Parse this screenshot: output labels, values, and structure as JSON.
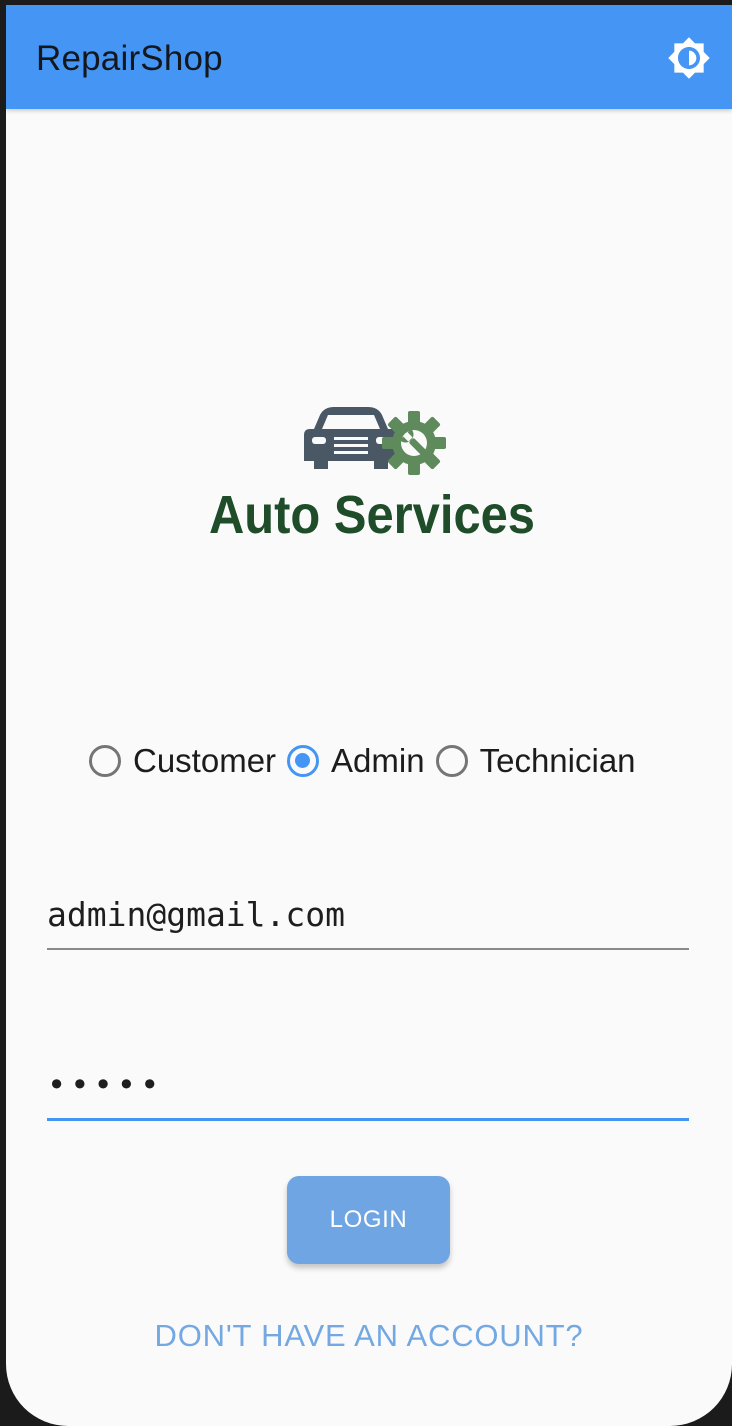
{
  "colors": {
    "primary": "#4596f4",
    "button_disabled": "#6fa5e2",
    "link": "#74a8e3",
    "logo_dark": "#4a5866",
    "logo_green": "#5f8a5c",
    "logo_text": "#1f4d2a"
  },
  "appbar": {
    "title": "RepairShop",
    "theme_icon": "brightness-icon"
  },
  "logo": {
    "text": "Auto Services",
    "icons": [
      "car-icon",
      "gear-wrench-icon"
    ]
  },
  "role_selector": {
    "options": [
      {
        "label": "Customer",
        "checked": false
      },
      {
        "label": "Admin",
        "checked": true
      },
      {
        "label": "Technician",
        "checked": false
      }
    ],
    "selected": "Admin"
  },
  "form": {
    "email": {
      "value": "admin@gmail.com"
    },
    "password": {
      "value": "•••••"
    }
  },
  "login_button": {
    "label": "LOGIN"
  },
  "signup_link": {
    "label": "DON'T HAVE AN ACCOUNT?"
  }
}
